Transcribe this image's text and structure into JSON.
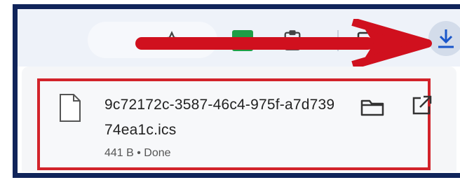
{
  "download_item": {
    "filename": "9c72172c-3587-46c4-975f-a7d73974ea1c.ics",
    "status": "441 B • Done"
  },
  "icons": {
    "file": "file-icon",
    "folder": "folder-icon",
    "open": "open-external-icon",
    "download": "download-icon",
    "star": "star-icon",
    "clipboard": "clipboard-icon",
    "side_panel": "side-panel-icon"
  },
  "colors": {
    "frame_border": "#10245a",
    "highlight_box": "#d2232a",
    "arrow": "#d0101e",
    "download_button_bg": "#d3dcea",
    "download_icon": "#1a56c9",
    "extension_green": "#1e9e46"
  }
}
